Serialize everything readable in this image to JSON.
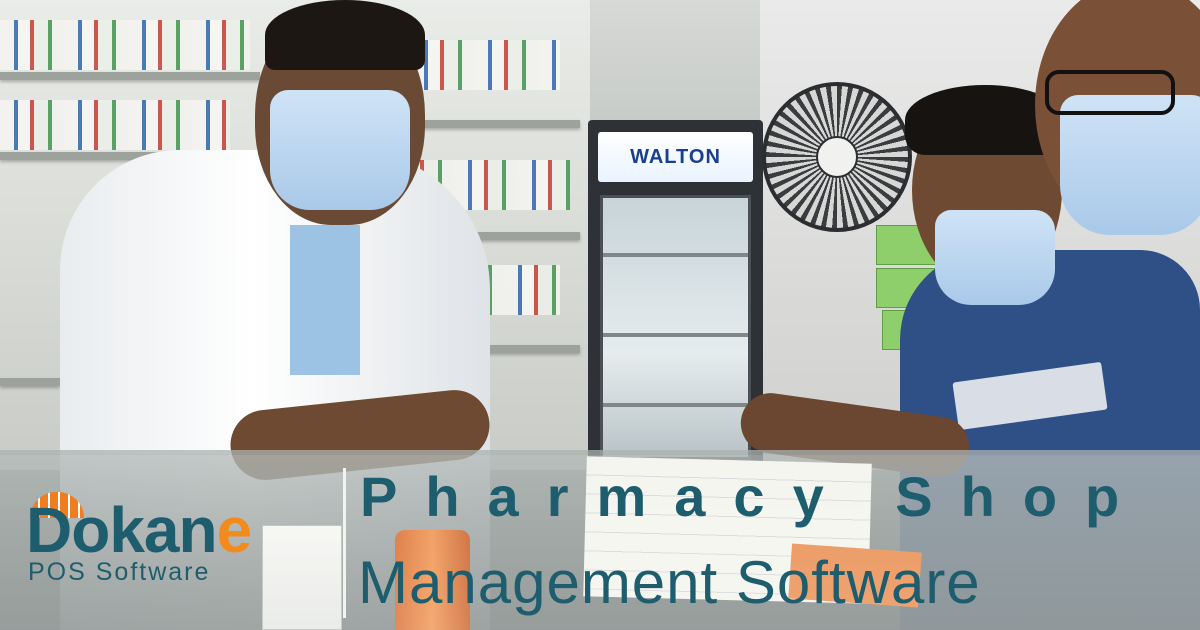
{
  "photo": {
    "fridge_brand": "WALTON"
  },
  "brand": {
    "logo_main": "Dokan",
    "logo_accent": "e",
    "logo_sub": "POS Software",
    "icon": "shop-roof-icon"
  },
  "headline": {
    "line1": "Pharmacy Shop",
    "line2": "Management Software"
  },
  "colors": {
    "brand_teal": "#1e5d6d",
    "brand_orange": "#f28a1c"
  }
}
